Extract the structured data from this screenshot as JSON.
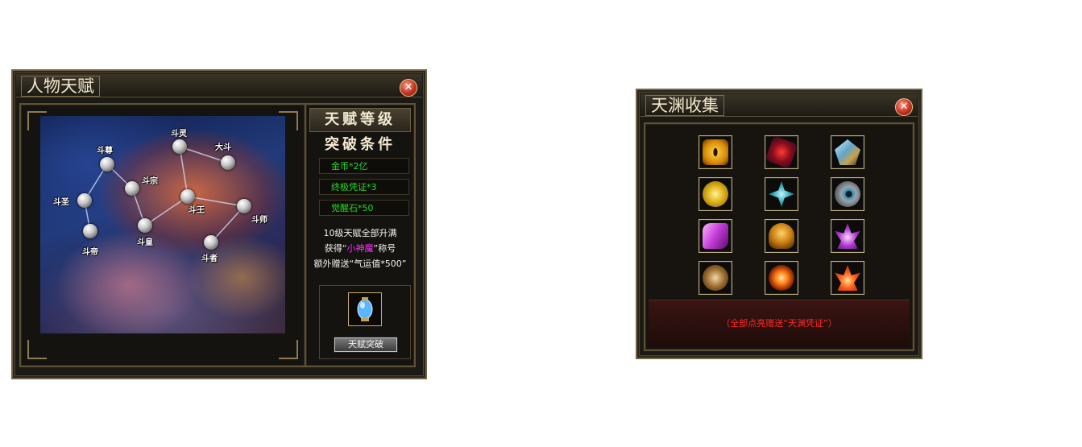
{
  "talent_window": {
    "title": "人物天赋",
    "close_glyph": "✕",
    "constellation_nodes": [
      {
        "id": "douzun",
        "label": "斗尊"
      },
      {
        "id": "dousheng",
        "label": "斗圣"
      },
      {
        "id": "douzong",
        "label": "斗宗"
      },
      {
        "id": "douling",
        "label": "斗灵"
      },
      {
        "id": "dadou",
        "label": "大斗"
      },
      {
        "id": "douwang",
        "label": "斗王"
      },
      {
        "id": "doushi",
        "label": "斗师"
      },
      {
        "id": "douhuang",
        "label": "斗皇"
      },
      {
        "id": "doudi",
        "label": "斗帝"
      },
      {
        "id": "douzhe",
        "label": "斗者"
      }
    ],
    "right_panel": {
      "level_header": "天赋等级",
      "break_header": "突破条件",
      "requirements": [
        "金币*2亿",
        "终极凭证*3",
        "觉醒石*50"
      ],
      "desc_line1": "10级天赋全部升满",
      "desc_line2_prefix": "获得“",
      "desc_line2_highlight": "小神魔",
      "desc_line2_suffix": "”称号",
      "desc_line3": "额外赠送“气运值*500”",
      "item_icon": "blue-crystal-potion-icon",
      "breakthrough_button": "天赋突破"
    }
  },
  "abyss_window": {
    "title": "天渊收集",
    "close_glyph": "✕",
    "items": [
      {
        "name": "golden-eye-icon"
      },
      {
        "name": "red-crystal-icon"
      },
      {
        "name": "ice-shard-icon"
      },
      {
        "name": "gold-medallion-icon"
      },
      {
        "name": "teal-star-icon"
      },
      {
        "name": "stone-orb-icon"
      },
      {
        "name": "purple-glove-icon"
      },
      {
        "name": "golden-helmet-icon"
      },
      {
        "name": "purple-lotus-icon"
      },
      {
        "name": "bronze-claw-icon"
      },
      {
        "name": "fire-orb-icon"
      },
      {
        "name": "red-lotus-icon"
      }
    ],
    "reward_note": "（全部点亮赠送“天渊凭证”）"
  },
  "colors": {
    "requirement_green": "#22dd22",
    "highlight_pink": "#ff33ff",
    "note_red": "#ff2a2a",
    "frame_gold": "#6e6346"
  }
}
